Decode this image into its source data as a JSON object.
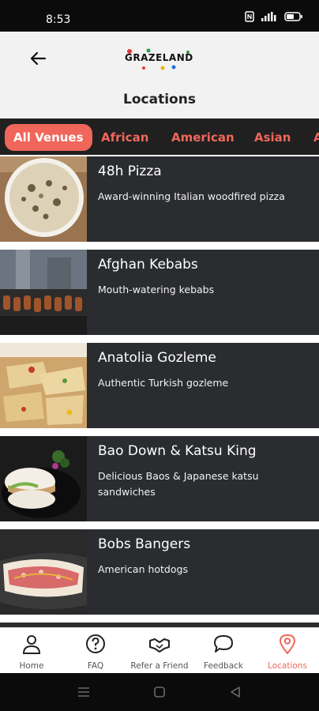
{
  "status_bar": {
    "time": "8:53",
    "icons": [
      "nfc-icon",
      "signal-icon",
      "battery-icon"
    ]
  },
  "header": {
    "back_icon": "arrow-left-icon",
    "logo_text": "GRAZELAND",
    "title": "Locations"
  },
  "tabs": [
    {
      "label": "All Venues",
      "active": true
    },
    {
      "label": "African",
      "active": false
    },
    {
      "label": "American",
      "active": false
    },
    {
      "label": "Asian",
      "active": false
    },
    {
      "label": "A",
      "active": false
    }
  ],
  "venues": [
    {
      "name": "48h Pizza",
      "description": "Award-winning Italian woodfired pizza"
    },
    {
      "name": "Afghan Kebabs",
      "description": "Mouth-watering kebabs"
    },
    {
      "name": "Anatolia Gozleme",
      "description": "Authentic Turkish gozleme"
    },
    {
      "name": "Bao Down & Katsu King",
      "description": "Delicious Baos & Japanese katsu sandwiches"
    },
    {
      "name": "Bobs Bangers",
      "description": "American hotdogs"
    }
  ],
  "bottom_nav": [
    {
      "label": "Home",
      "icon": "person-icon",
      "active": false
    },
    {
      "label": "FAQ",
      "icon": "question-icon",
      "active": false
    },
    {
      "label": "Refer a Friend",
      "icon": "handshake-icon",
      "active": false
    },
    {
      "label": "Feedback",
      "icon": "speech-bubble-icon",
      "active": false
    },
    {
      "label": "Locations",
      "icon": "map-pin-icon",
      "active": true
    }
  ],
  "colors": {
    "accent": "#f0665a",
    "card_bg": "#2a2c2f",
    "tab_bar_bg": "#202020",
    "header_bg": "#f2f2f2"
  }
}
